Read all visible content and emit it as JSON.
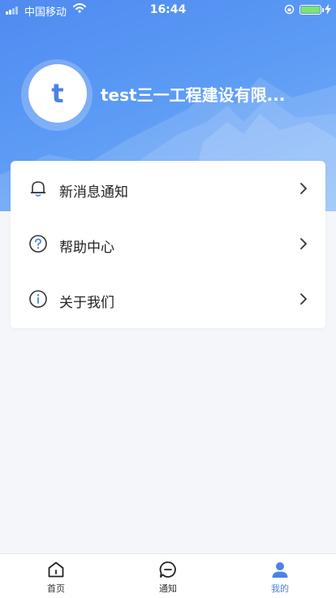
{
  "status_bar": {
    "carrier": "中国移动",
    "time": "16:44"
  },
  "profile": {
    "avatar_letter": "t",
    "company_name": "test三一工程建设有限..."
  },
  "menu": {
    "items": [
      {
        "label": "新消息通知",
        "icon": "bell-icon"
      },
      {
        "label": "帮助中心",
        "icon": "question-circle-icon"
      },
      {
        "label": "关于我们",
        "icon": "info-circle-icon"
      }
    ]
  },
  "tabbar": {
    "tabs": [
      {
        "label": "首页",
        "icon": "home-icon",
        "active": false
      },
      {
        "label": "通知",
        "icon": "message-icon",
        "active": false
      },
      {
        "label": "我的",
        "icon": "user-icon",
        "active": true
      }
    ]
  },
  "colors": {
    "accent": "#4b82e6",
    "hero_start": "#4f8bf0",
    "hero_end": "#79b2f7",
    "background": "#f4f6fa"
  }
}
